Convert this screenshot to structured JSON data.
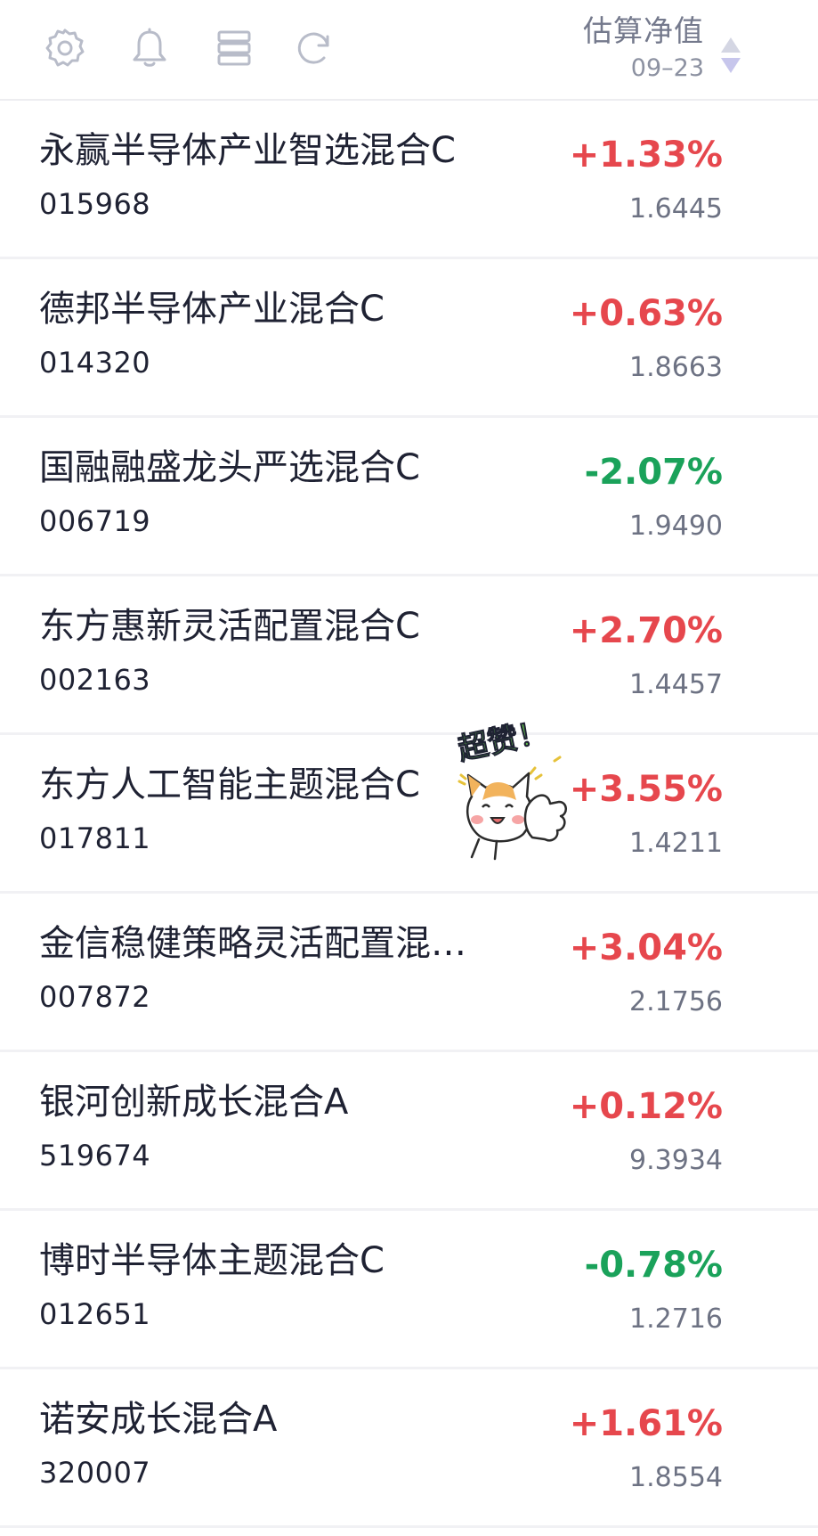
{
  "header": {
    "icons": [
      "settings-icon",
      "bell-icon",
      "list-icon",
      "refresh-icon"
    ],
    "column_title": "估算净值",
    "column_date": "09–23"
  },
  "sticker": {
    "text": "超赞！"
  },
  "colors": {
    "up": "#e6474d",
    "down": "#1aa25a",
    "text": "#1f2233",
    "muted": "#6d7283",
    "divider": "#f1f1f4"
  },
  "funds": [
    {
      "name": "永赢半导体产业智选混合C",
      "code": "015968",
      "change": "+1.33%",
      "nav": "1.6445",
      "direction": "up"
    },
    {
      "name": "德邦半导体产业混合C",
      "code": "014320",
      "change": "+0.63%",
      "nav": "1.8663",
      "direction": "up"
    },
    {
      "name": "国融融盛龙头严选混合C",
      "code": "006719",
      "change": "-2.07%",
      "nav": "1.9490",
      "direction": "down"
    },
    {
      "name": "东方惠新灵活配置混合C",
      "code": "002163",
      "change": "+2.70%",
      "nav": "1.4457",
      "direction": "up"
    },
    {
      "name": "东方人工智能主题混合C",
      "code": "017811",
      "change": "+3.55%",
      "nav": "1.4211",
      "direction": "up"
    },
    {
      "name": "金信稳健策略灵活配置混…",
      "code": "007872",
      "change": "+3.04%",
      "nav": "2.1756",
      "direction": "up"
    },
    {
      "name": "银河创新成长混合A",
      "code": "519674",
      "change": "+0.12%",
      "nav": "9.3934",
      "direction": "up"
    },
    {
      "name": "博时半导体主题混合C",
      "code": "012651",
      "change": "-0.78%",
      "nav": "1.2716",
      "direction": "down"
    },
    {
      "name": "诺安成长混合A",
      "code": "320007",
      "change": "+1.61%",
      "nav": "1.8554",
      "direction": "up"
    }
  ]
}
